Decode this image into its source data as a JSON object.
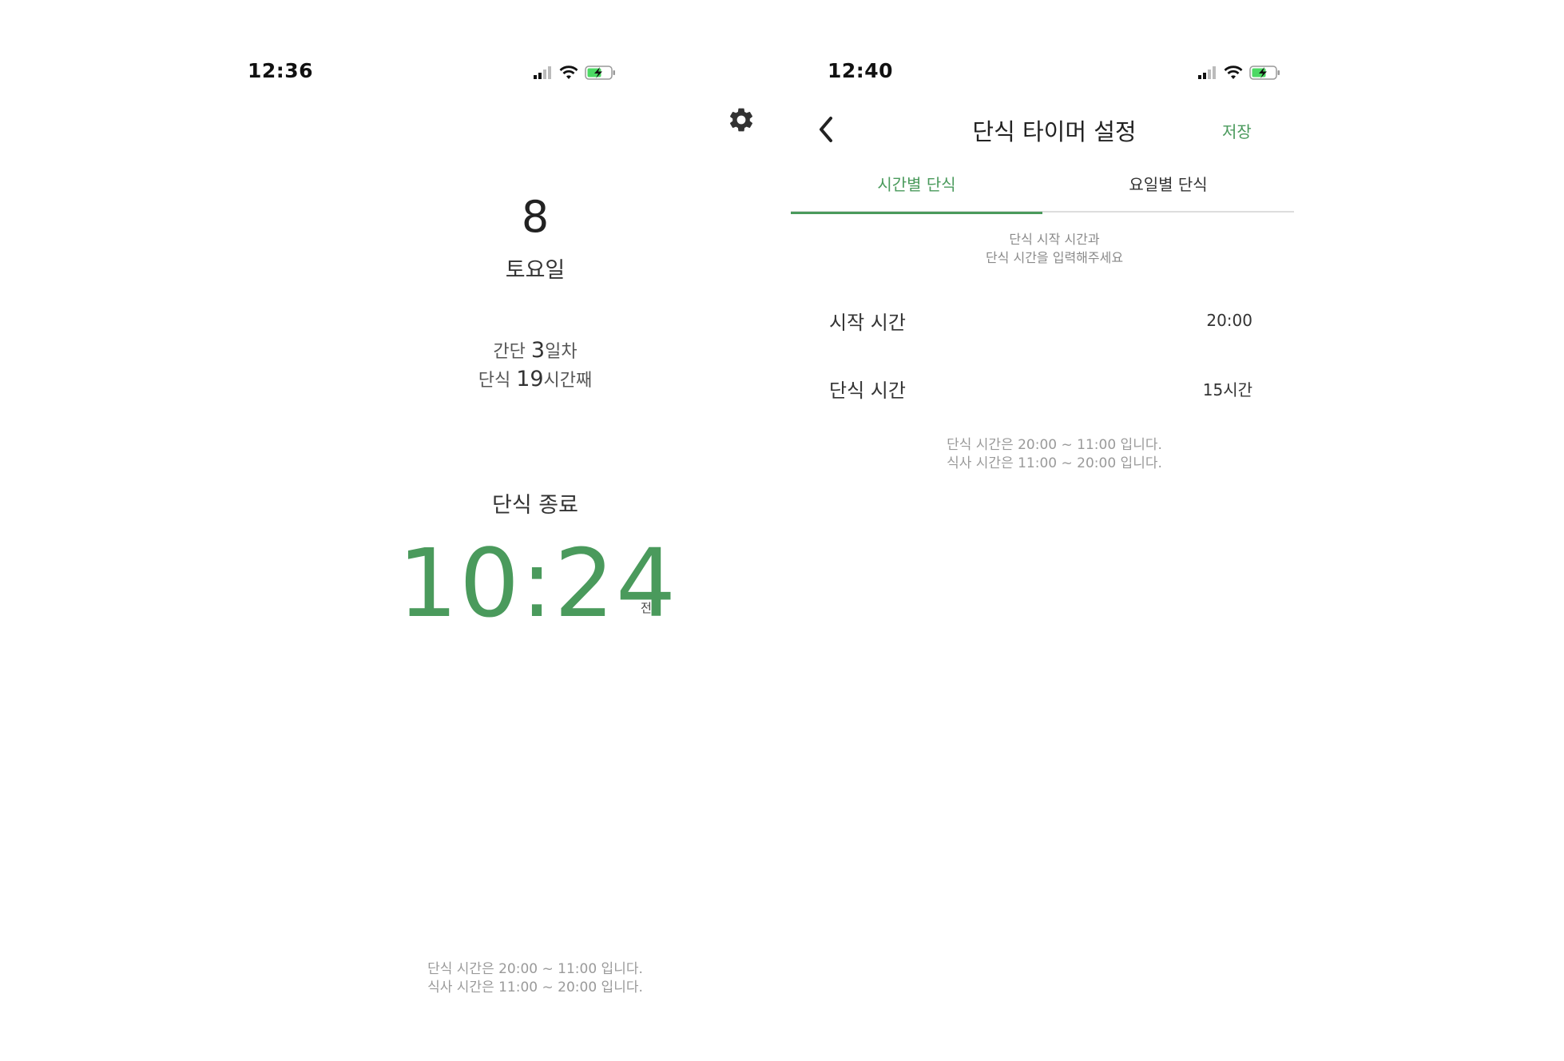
{
  "screens": {
    "home": {
      "status_time": "12:36",
      "date_number": "8",
      "weekday": "토요일",
      "streak": {
        "line1_prefix": "간단 ",
        "line1_value": "3",
        "line1_suffix": "일차",
        "line2_prefix": "단식 ",
        "line2_value": "19",
        "line2_suffix": "시간째"
      },
      "end_label": "단식 종료",
      "end_time": "10:24",
      "end_ampm": "전",
      "footer": {
        "line1": "단식 시간은 20:00 ~ 11:00 입니다.",
        "line2": "식사 시간은 11:00 ~ 20:00 입니다."
      }
    },
    "settings": {
      "status_time": "12:40",
      "title": "단식 타이머 설정",
      "save_label": "저장",
      "tabs": [
        {
          "label": "시간별 단식",
          "active": true
        },
        {
          "label": "요일별 단식",
          "active": false
        }
      ],
      "instruction": {
        "line1": "단식 시작 시간과",
        "line2": "단식 시간을 입력해주세요"
      },
      "rows": [
        {
          "label": "시작 시간",
          "value": "20:00"
        },
        {
          "label": "단식 시간",
          "value": "15시간"
        }
      ],
      "summary": {
        "line1": "단식 시간은 20:00 ~ 11:00 입니다.",
        "line2": "식사 시간은 11:00 ~ 20:00 입니다."
      }
    }
  },
  "colors": {
    "accent": "#4a9a5c",
    "battery_fill": "#4cd964",
    "muted_text": "#9a9a9a"
  },
  "icons": {
    "gear": "gear-icon",
    "back": "chevron-left-icon",
    "signal": "cellular-signal-icon",
    "wifi": "wifi-icon",
    "battery": "battery-charging-icon"
  }
}
